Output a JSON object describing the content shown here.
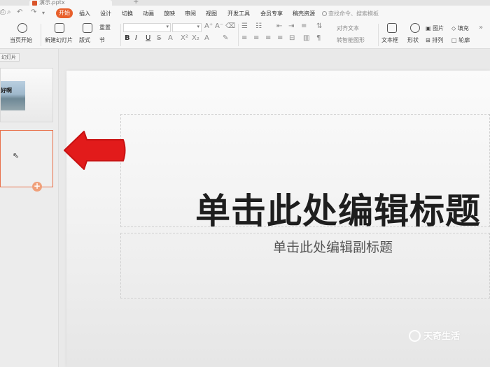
{
  "document": {
    "tab_name": "演示.pptx"
  },
  "menu": {
    "tabs": [
      "开始",
      "插入",
      "设计",
      "切换",
      "动画",
      "放映",
      "审阅",
      "视图",
      "开发工具",
      "会员专享",
      "稿壳资源"
    ],
    "active": "开始",
    "search_placeholder": "查找命令、搜索模板"
  },
  "ribbon": {
    "play_from_current": "当页开始",
    "new_slide": "新建幻灯片",
    "layout": "版式",
    "reset": "重置",
    "section": "节",
    "align_text": "对齐文本",
    "smartart": "转智能图形",
    "textbox": "文本框",
    "shape": "形状",
    "picture": "图片",
    "arrange": "排列",
    "fill": "填充",
    "outline": "轮廓"
  },
  "panel": {
    "label": "幻灯片"
  },
  "thumbnails": [
    {
      "text": "好啊"
    },
    {
      "text": ""
    }
  ],
  "slide": {
    "title_placeholder": "单击此处编辑标题",
    "subtitle_placeholder": "单击此处编辑副标题"
  },
  "annotation": {
    "arrow_color": "#e21b1b"
  },
  "watermark": {
    "text": "天奇生活"
  },
  "colors": {
    "accent": "#e8602c",
    "selection_border": "#e8704a"
  }
}
